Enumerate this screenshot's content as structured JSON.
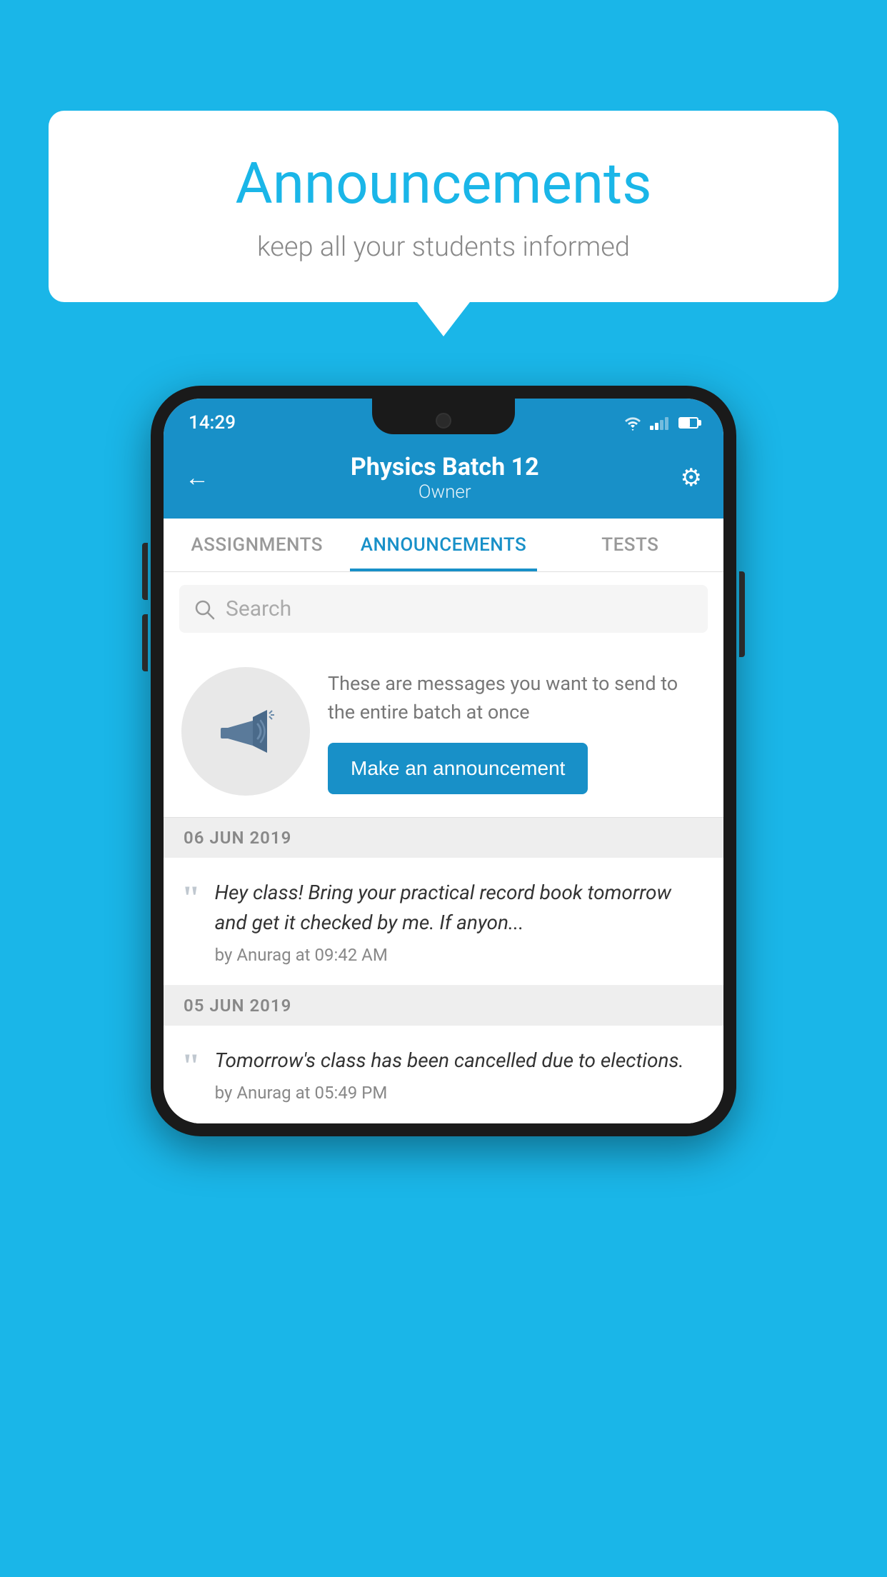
{
  "background_color": "#1ab6e8",
  "speech_bubble": {
    "title": "Announcements",
    "subtitle": "keep all your students informed"
  },
  "status_bar": {
    "time": "14:29",
    "wifi": "▼",
    "battery_level": 60
  },
  "app_header": {
    "title": "Physics Batch 12",
    "subtitle": "Owner",
    "back_icon": "←",
    "settings_icon": "⚙"
  },
  "tabs": [
    {
      "label": "ASSIGNMENTS",
      "active": false
    },
    {
      "label": "ANNOUNCEMENTS",
      "active": true
    },
    {
      "label": "TESTS",
      "active": false
    },
    {
      "label": "...",
      "active": false
    }
  ],
  "search": {
    "placeholder": "Search"
  },
  "announcement_promo": {
    "promo_text": "These are messages you want to send to the entire batch at once",
    "button_label": "Make an announcement"
  },
  "announcement_groups": [
    {
      "date": "06  JUN  2019",
      "items": [
        {
          "text": "Hey class! Bring your practical record book tomorrow and get it checked by me. If anyon...",
          "meta": "by Anurag at 09:42 AM"
        }
      ]
    },
    {
      "date": "05  JUN  2019",
      "items": [
        {
          "text": "Tomorrow's class has been cancelled due to elections.",
          "meta": "by Anurag at 05:49 PM"
        }
      ]
    }
  ]
}
